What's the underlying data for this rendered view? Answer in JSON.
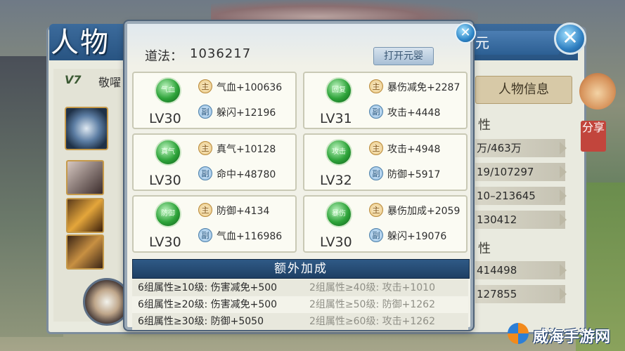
{
  "background": {
    "title": "人物",
    "tab_right": "元",
    "close_label": "✕",
    "vip": "V7",
    "name_fragment": "敬嚁",
    "info_tab": "人物信息",
    "section_labels": [
      "性",
      "性"
    ],
    "rows_upper": [
      "万/463万",
      "19/107297",
      "10–213645",
      "130412"
    ],
    "rows_lower": [
      "414498",
      "127855"
    ],
    "share": "分享"
  },
  "popup": {
    "daofa_label": "道法：",
    "daofa_value": "1036217",
    "open_button": "打开元婴",
    "close_label": "✕",
    "cards": [
      {
        "gem": "气血",
        "level": "LV30",
        "main_badge": "主",
        "main_stat": "气血+100636",
        "sub_badge": "副",
        "sub_stat": "躲闪+12196"
      },
      {
        "gem": "回复",
        "level": "LV31",
        "main_badge": "主",
        "main_stat": "暴伤减免+2287",
        "sub_badge": "副",
        "sub_stat": "攻击+4448"
      },
      {
        "gem": "真气",
        "level": "LV30",
        "main_badge": "主",
        "main_stat": "真气+10128",
        "sub_badge": "副",
        "sub_stat": "命中+48780"
      },
      {
        "gem": "攻击",
        "level": "LV32",
        "main_badge": "主",
        "main_stat": "攻击+4948",
        "sub_badge": "副",
        "sub_stat": "防御+5917"
      },
      {
        "gem": "防御",
        "level": "LV30",
        "main_badge": "主",
        "main_stat": "防御+4134",
        "sub_badge": "副",
        "sub_stat": "气血+116986"
      },
      {
        "gem": "暴伤",
        "level": "LV30",
        "main_badge": "主",
        "main_stat": "暴伤加成+2059",
        "sub_badge": "副",
        "sub_stat": "躲闪+19076"
      }
    ],
    "bonus_title": "额外加成",
    "bonus_rows": [
      {
        "left": "6组属性≥10级: 伤害减免+500",
        "right": "2组属性≥40级: 攻击+1010"
      },
      {
        "left": "6组属性≥20级: 伤害减免+500",
        "right": "2组属性≥50级: 防御+1262"
      },
      {
        "left": "6组属性≥30级: 防御+5050",
        "right": "2组属性≥60级: 攻击+1262"
      }
    ]
  },
  "watermark": "威海手游网"
}
